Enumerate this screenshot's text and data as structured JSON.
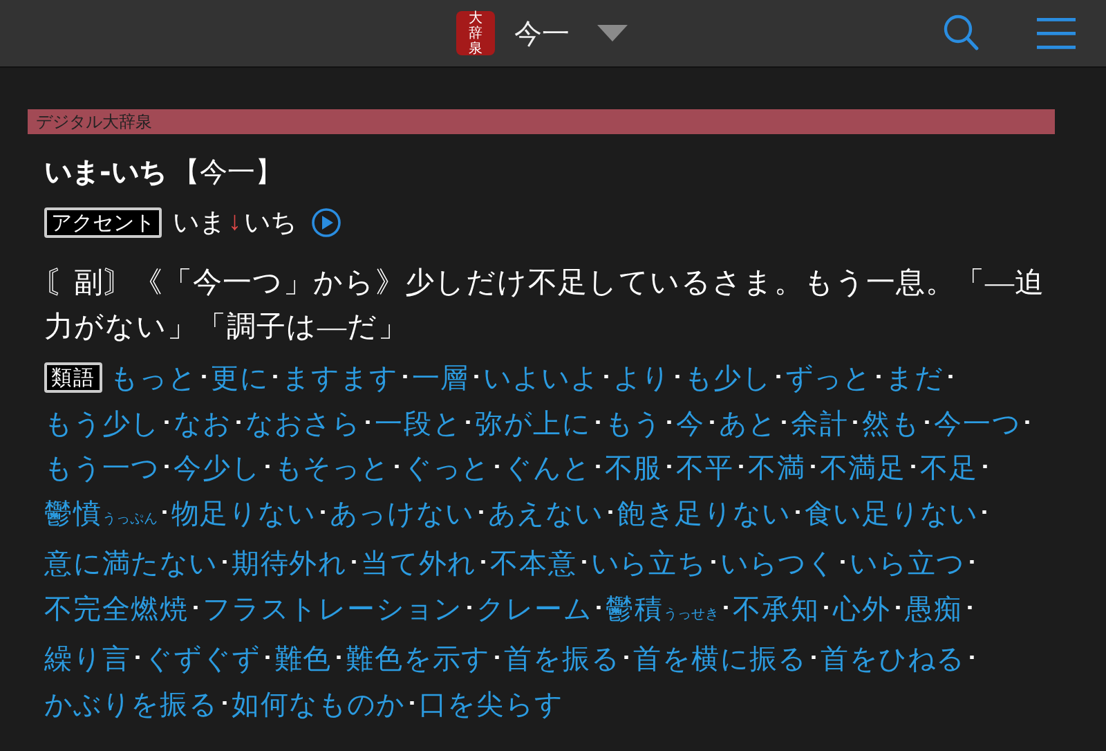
{
  "header": {
    "logo": "大辞泉",
    "title": "今一"
  },
  "entry": {
    "source": "デジタル大辞泉",
    "headword": "いま-いち",
    "kanji": "【今一】",
    "accent": {
      "label": "アクセント",
      "before": "いま",
      "mark": "↓",
      "after": "いち"
    },
    "definition": "〘副〙《「今一つ」から》少しだけ不足しているさま。もう一息。「―迫力がない」「調子は―だ」",
    "synonyms": {
      "label": "類語",
      "separator": "･",
      "items": [
        {
          "text": "もっと"
        },
        {
          "text": "更に"
        },
        {
          "text": "ますます"
        },
        {
          "text": "一層"
        },
        {
          "text": "いよいよ"
        },
        {
          "text": "より"
        },
        {
          "text": "も少し"
        },
        {
          "text": "ずっと"
        },
        {
          "text": "まだ"
        },
        {
          "text": "もう少し"
        },
        {
          "text": "なお"
        },
        {
          "text": "なおさら"
        },
        {
          "text": "一段と"
        },
        {
          "text": "弥が上に"
        },
        {
          "text": "もう"
        },
        {
          "text": "今"
        },
        {
          "text": "あと"
        },
        {
          "text": "余計"
        },
        {
          "text": "然も"
        },
        {
          "text": "今一つ"
        },
        {
          "text": "もう一つ"
        },
        {
          "text": "今少し"
        },
        {
          "text": "もそっと"
        },
        {
          "text": "ぐっと"
        },
        {
          "text": "ぐんと"
        },
        {
          "text": "不服"
        },
        {
          "text": "不平"
        },
        {
          "text": "不満"
        },
        {
          "text": "不満足"
        },
        {
          "text": "不足"
        },
        {
          "text": "鬱憤",
          "reading": "うっぷん"
        },
        {
          "text": "物足りない"
        },
        {
          "text": "あっけない"
        },
        {
          "text": "あえない"
        },
        {
          "text": "飽き足りない"
        },
        {
          "text": "食い足りない"
        },
        {
          "text": "意に満たない"
        },
        {
          "text": "期待外れ"
        },
        {
          "text": "当て外れ"
        },
        {
          "text": "不本意"
        },
        {
          "text": "いら立ち"
        },
        {
          "text": "いらつく"
        },
        {
          "text": "いら立つ"
        },
        {
          "text": "不完全燃焼"
        },
        {
          "text": "フラストレーション"
        },
        {
          "text": "クレーム"
        },
        {
          "text": "鬱積",
          "reading": "うっせき"
        },
        {
          "text": "不承知"
        },
        {
          "text": "心外"
        },
        {
          "text": "愚痴"
        },
        {
          "text": "繰り言"
        },
        {
          "text": "ぐずぐず"
        },
        {
          "text": "難色"
        },
        {
          "text": "難色を示す"
        },
        {
          "text": "首を振る"
        },
        {
          "text": "首を横に振る"
        },
        {
          "text": "首をひねる"
        },
        {
          "text": "かぶりを振る"
        },
        {
          "text": "如何なものか"
        },
        {
          "text": "口を尖らす"
        }
      ]
    }
  }
}
